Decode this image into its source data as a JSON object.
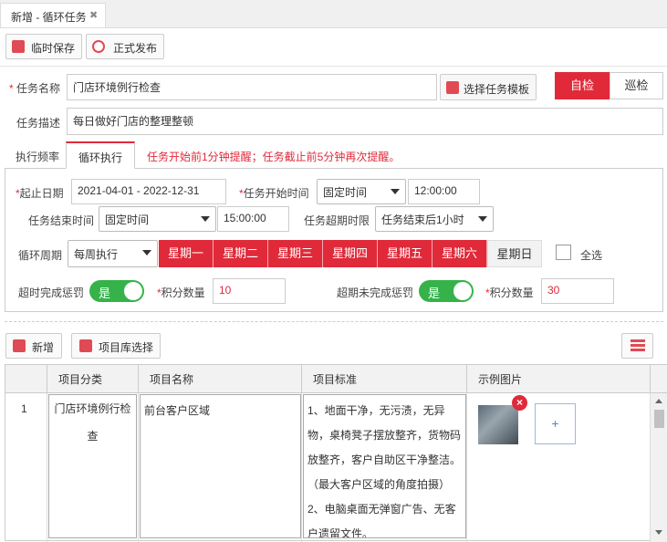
{
  "tab": {
    "title": "新增 - 循环任务",
    "close": "✖"
  },
  "toolbar": {
    "temp_save": "临时保存",
    "publish": "正式发布"
  },
  "form": {
    "task_name_label": "任务名称",
    "task_name_value": "门店环境例行检查",
    "choose_template": "选择任务模板",
    "mode_self": "自检",
    "mode_patrol": "巡检",
    "desc_label": "任务描述",
    "desc_value": "每日做好门店的整理整顿"
  },
  "subtabs": {
    "freq": "执行频率",
    "cycle": "循环执行",
    "reminder": "任务开始前1分钟提醒；任务截止前5分钟再次提醒。"
  },
  "cycle": {
    "date_label": "起止日期",
    "date_value": "2021-04-01 - 2022-12-31",
    "start_label": "任务开始时间",
    "start_mode": "固定时间",
    "start_time": "12:00:00",
    "end_label": "任务结束时间",
    "end_mode": "固定时间",
    "end_time": "15:00:00",
    "timeout_label": "任务超期时限",
    "timeout_value": "任务结束后1小时",
    "period_label": "循环周期",
    "period_value": "每周执行",
    "days": [
      "星期一",
      "星期二",
      "星期三",
      "星期四",
      "星期五",
      "星期六",
      "星期日"
    ],
    "days_selected": [
      true,
      true,
      true,
      true,
      true,
      true,
      false
    ],
    "select_all": "全选",
    "late_penalty_label": "超时完成惩罚",
    "late_penalty_toggle": "是",
    "points_label": "积分数量",
    "late_points": "10",
    "miss_penalty_label": "超期未完成惩罚",
    "miss_penalty_toggle": "是",
    "miss_points": "30"
  },
  "items_toolbar": {
    "add": "新增",
    "library": "项目库选择"
  },
  "table": {
    "headers": [
      "项目分类",
      "项目名称",
      "项目标准",
      "示例图片"
    ],
    "rows": [
      {
        "index": "1",
        "category": "门店环境例行检查",
        "name": "前台客户区域",
        "standard": "1、地面干净，无污渍，无异物，桌椅凳子摆放整齐，货物码放整齐，客户自助区干净整洁。（最大客户区域的角度拍摄）2、电脑桌面无弹窗广告、无客户遗留文件。",
        "add_image": "+"
      }
    ]
  },
  "colors": {
    "primary": "#e02a3a",
    "toggle_on": "#35b34a"
  }
}
